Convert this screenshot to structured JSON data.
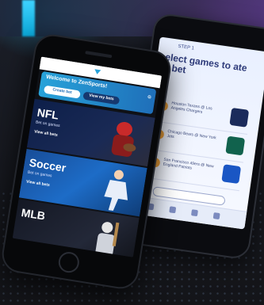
{
  "front_phone": {
    "welcome_text": "Welcome to ZenSports!",
    "buttons": [
      "Create bet",
      "View my bets"
    ],
    "tiles": [
      {
        "title": "NFL",
        "subtitle": "Bet on games",
        "cta": "View all bets"
      },
      {
        "title": "Soccer",
        "subtitle": "Bet on games",
        "cta": "View all bets"
      },
      {
        "title": "MLB",
        "subtitle": "",
        "cta": ""
      }
    ]
  },
  "back_phone": {
    "heading": "elect games to\nate a bet",
    "small": "STEP 1",
    "rows": [
      "Houston Texans @ Los Angeles Chargers",
      "Chicago Bears @ New York Jets",
      "San Francisco 49ers @ New England Patriots"
    ]
  },
  "colors": {
    "welcome_start": "#27a2d9",
    "welcome_end": "#1f6fb9",
    "nfl": "#1b2a4d",
    "soccer": "#1d6cc7",
    "mlb": "#1b1f2b"
  }
}
